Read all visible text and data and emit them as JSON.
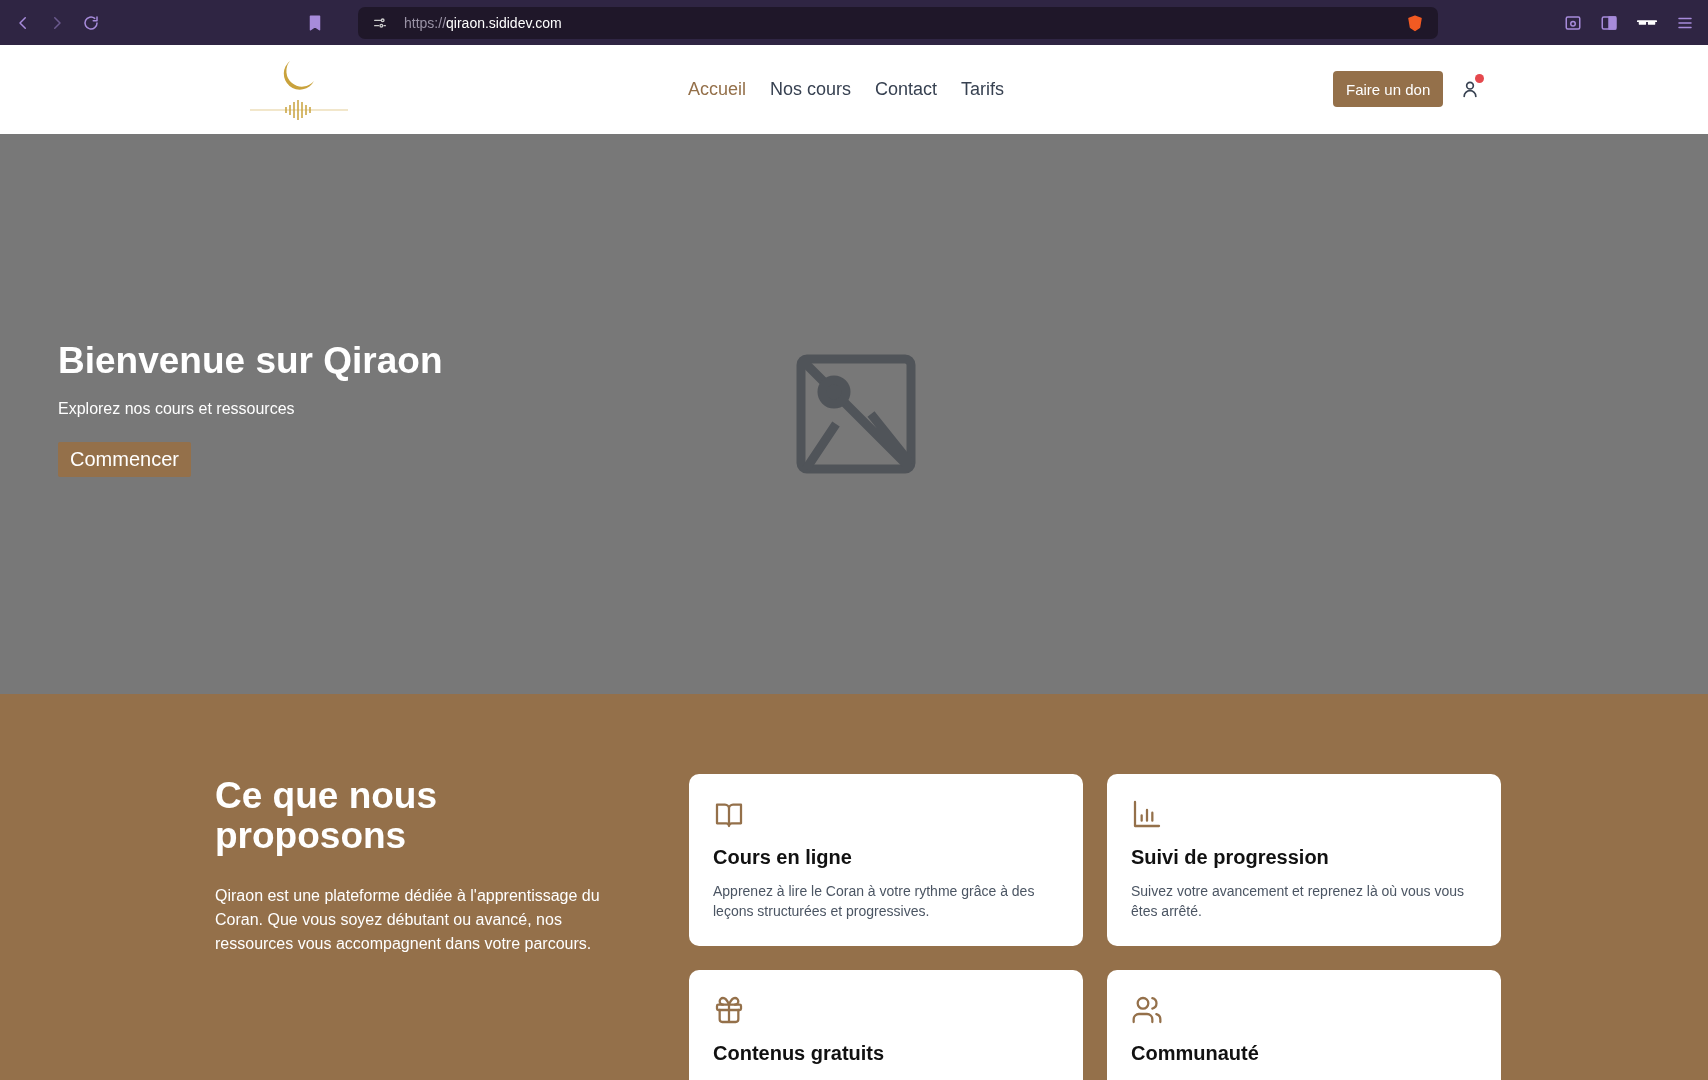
{
  "browser": {
    "url_scheme": "https://",
    "url_host": "qiraon.sididev.com"
  },
  "header": {
    "nav": [
      {
        "label": "Accueil",
        "selected": true
      },
      {
        "label": "Nos cours",
        "selected": false
      },
      {
        "label": "Contact",
        "selected": false
      },
      {
        "label": "Tarifs",
        "selected": false
      }
    ],
    "donate_button": "Faire un don",
    "notification": true
  },
  "hero": {
    "title": "Bienvenue sur Qiraon",
    "subtitle": "Explorez nos cours et ressources",
    "button": "Commencer"
  },
  "offer": {
    "title": "Ce que nous proposons",
    "text": "Qiraon est une plateforme dédiée à l'apprentissage du Coran. Que vous soyez débutant ou avancé, nos ressources vous accompagnent dans votre parcours.",
    "features": [
      {
        "kind": "book",
        "title": "Cours en ligne",
        "description": "Apprenez à lire le Coran à votre rythme grâce à des leçons structurées et progressives."
      },
      {
        "kind": "chart",
        "title": "Suivi de progression",
        "description": "Suivez votre avancement et reprenez là où vous vous êtes arrêté."
      },
      {
        "kind": "gift",
        "title": "Contenus gratuits"
      },
      {
        "kind": "users",
        "title": "Communauté"
      }
    ]
  }
}
